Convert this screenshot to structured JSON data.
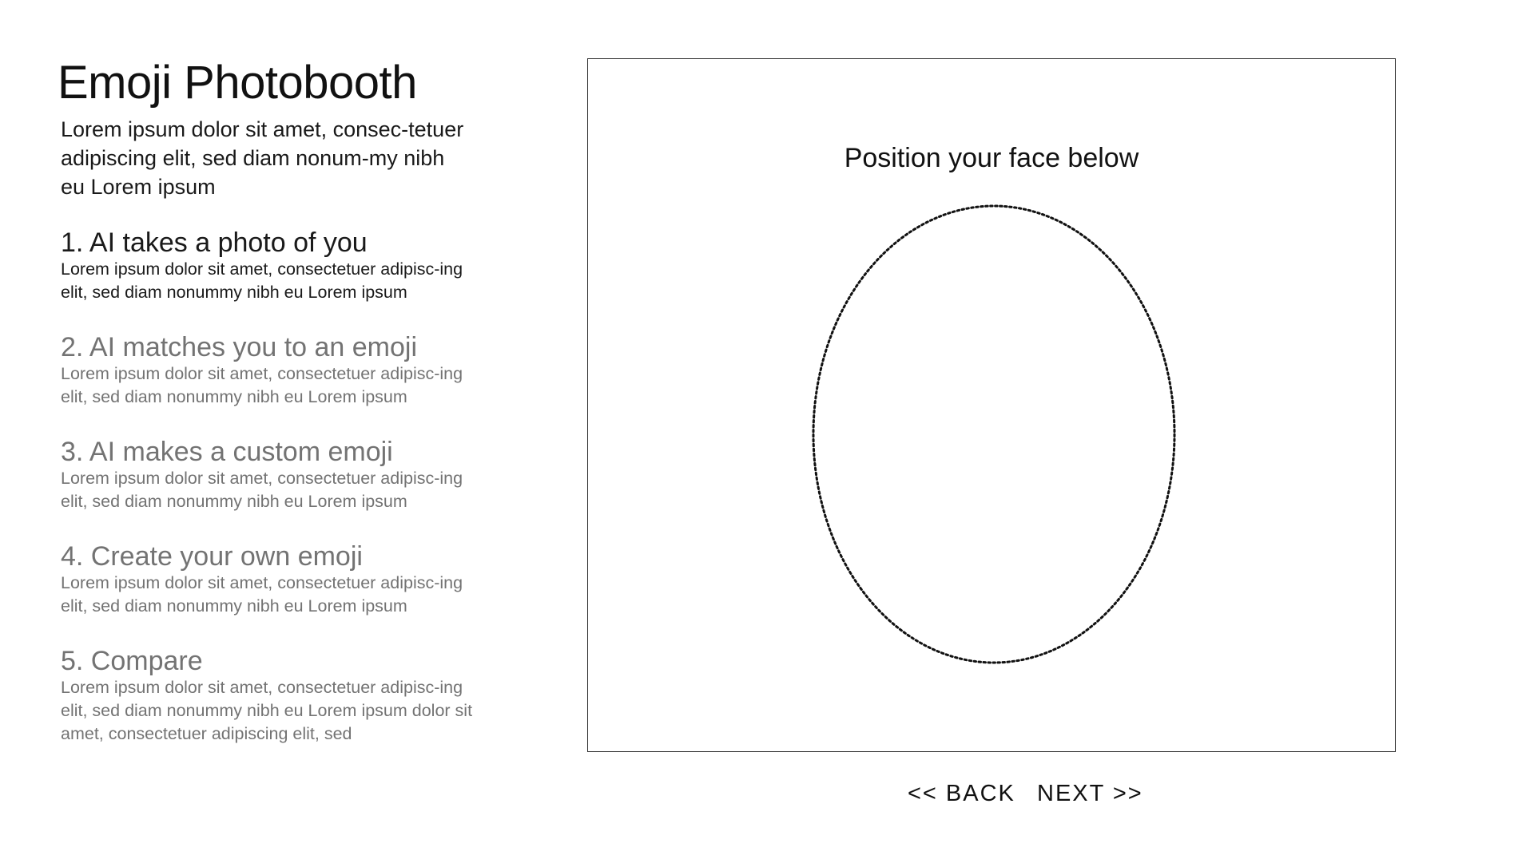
{
  "app": {
    "title": "Emoji Photobooth",
    "intro": "Lorem ipsum dolor sit amet, consec-tetuer adipiscing elit, sed diam nonum-my nibh eu Lorem ipsum"
  },
  "steps": [
    {
      "title": "1. AI takes a photo of you",
      "description": "Lorem ipsum dolor sit amet, consectetuer adipisc-ing elit, sed diam nonummy nibh eu Lorem ipsum",
      "active": true
    },
    {
      "title": "2. AI matches you to an emoji",
      "description": "Lorem ipsum dolor sit amet, consectetuer adipisc-ing elit, sed diam nonummy nibh eu Lorem ipsum",
      "active": false
    },
    {
      "title": "3. AI makes a custom emoji",
      "description": "Lorem ipsum dolor sit amet, consectetuer adipisc-ing elit, sed diam nonummy nibh eu Lorem ipsum",
      "active": false
    },
    {
      "title": "4. Create your own emoji",
      "description": "Lorem ipsum dolor sit amet, consectetuer adipisc-ing elit, sed diam nonummy nibh eu Lorem ipsum",
      "active": false
    },
    {
      "title": "5. Compare",
      "description": "Lorem ipsum dolor sit amet, consectetuer adipisc-ing elit, sed diam nonummy nibh eu Lorem ipsum dolor sit amet, consectetuer adipiscing elit, sed",
      "active": false
    }
  ],
  "camera": {
    "prompt": "Position your face below",
    "guide_shape": "dotted-oval"
  },
  "navigation": {
    "back_label": "<< BACK",
    "next_label": "NEXT >>"
  },
  "colors": {
    "active_text": "#1a1a1a",
    "inactive_text": "#737373",
    "frame_border": "#333333",
    "background": "#ffffff"
  }
}
